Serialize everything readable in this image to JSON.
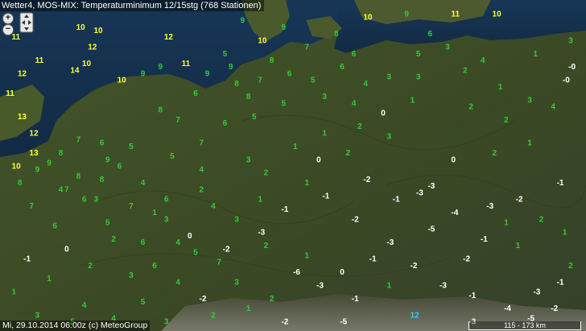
{
  "title": "Wetter4, MOS-MIX: Temperaturminimum 12/15stg (768 Stationen)",
  "footer": "Mi, 29.10.2014 06:00z (c) MeteoGroup",
  "scale_label": "115 - 173 km",
  "controls": {
    "zoom_in": "+",
    "zoom_out": "−"
  },
  "icons": {
    "pan": "pan-arrows-icon"
  },
  "colors": {
    "sea": "#15314e",
    "land": "#3a4a24",
    "cold": "#ffffff",
    "mild": "#33cc33",
    "warm": "#ffff33",
    "special": "#33ccff"
  },
  "stations": [
    [
      "10",
      13,
      8
    ],
    [
      "10",
      16,
      9
    ],
    [
      "11",
      2,
      11
    ],
    [
      "12",
      28,
      11
    ],
    [
      "12",
      15,
      14
    ],
    [
      "10",
      14,
      19
    ],
    [
      "14",
      12,
      21
    ],
    [
      "11",
      6,
      18
    ],
    [
      "12",
      3,
      22
    ],
    [
      "11",
      1,
      28
    ],
    [
      "13",
      3,
      35
    ],
    [
      "12",
      5,
      40
    ],
    [
      "13",
      5,
      46
    ],
    [
      "10",
      2,
      50
    ],
    [
      "9",
      8,
      49
    ],
    [
      "8",
      10,
      46
    ],
    [
      "7",
      13,
      42
    ],
    [
      "6",
      17,
      43
    ],
    [
      "5",
      22,
      44
    ],
    [
      "6",
      20,
      50
    ],
    [
      "4",
      24,
      55
    ],
    [
      "6",
      28,
      60
    ],
    [
      "4",
      30,
      73
    ],
    [
      "5",
      33,
      76
    ],
    [
      "7",
      37,
      79
    ],
    [
      "6",
      26,
      80
    ],
    [
      "6",
      24,
      73
    ],
    [
      "5",
      18,
      67
    ],
    [
      "7",
      22,
      62
    ],
    [
      "6",
      14,
      60
    ],
    [
      "8",
      13,
      53
    ],
    [
      "7",
      11,
      57
    ],
    [
      "8",
      17,
      54
    ],
    [
      "9",
      18,
      48
    ],
    [
      "10",
      20,
      24
    ],
    [
      "9",
      24,
      22
    ],
    [
      "9",
      27,
      20
    ],
    [
      "11",
      31,
      19
    ],
    [
      "9",
      35,
      22
    ],
    [
      "8",
      40,
      25
    ],
    [
      "7",
      44,
      24
    ],
    [
      "6",
      49,
      22
    ],
    [
      "5",
      53,
      24
    ],
    [
      "6",
      58,
      20
    ],
    [
      "4",
      62,
      25
    ],
    [
      "3",
      66,
      23
    ],
    [
      "3",
      71,
      23
    ],
    [
      "2",
      79,
      21
    ],
    [
      "1",
      85,
      26
    ],
    [
      "-0",
      96,
      24
    ],
    [
      "1",
      90,
      43
    ],
    [
      "2",
      84,
      46
    ],
    [
      "0",
      77,
      48
    ],
    [
      "-3",
      71,
      58
    ],
    [
      "-1",
      67,
      60
    ],
    [
      "-3",
      73,
      56
    ],
    [
      "-2",
      62,
      54
    ],
    [
      "-1",
      55,
      59
    ],
    [
      "1",
      52,
      55
    ],
    [
      "2",
      45,
      52
    ],
    [
      "3",
      42,
      48
    ],
    [
      "1",
      50,
      44
    ],
    [
      "1",
      55,
      40
    ],
    [
      "2",
      61,
      38
    ],
    [
      "3",
      66,
      41
    ],
    [
      "4",
      60,
      31
    ],
    [
      "3",
      55,
      29
    ],
    [
      "5",
      48,
      31
    ],
    [
      "5",
      43,
      35
    ],
    [
      "6",
      38,
      37
    ],
    [
      "7",
      34,
      43
    ],
    [
      "5",
      29,
      47
    ],
    [
      "4",
      34,
      51
    ],
    [
      "4",
      36,
      62
    ],
    [
      "3",
      40,
      66
    ],
    [
      "2",
      45,
      74
    ],
    [
      "1",
      52,
      77
    ],
    [
      "0",
      58,
      82
    ],
    [
      "-1",
      63,
      78
    ],
    [
      "-2",
      70,
      80
    ],
    [
      "-3",
      75,
      86
    ],
    [
      "-1",
      80,
      89
    ],
    [
      "-4",
      86,
      93
    ],
    [
      "-3",
      91,
      88
    ],
    [
      "-1",
      95,
      85
    ],
    [
      "2",
      98,
      80
    ],
    [
      "1",
      96,
      70
    ],
    [
      "2",
      92,
      66
    ],
    [
      "1",
      86,
      67
    ],
    [
      "-1",
      82,
      72
    ],
    [
      "-2",
      79,
      78
    ],
    [
      "1",
      88,
      74
    ],
    [
      "3",
      40,
      85
    ],
    [
      "4",
      30,
      85
    ],
    [
      "3",
      22,
      83
    ],
    [
      "2",
      15,
      80
    ],
    [
      "1",
      8,
      84
    ],
    [
      "1",
      2,
      88
    ],
    [
      "3",
      6,
      95
    ],
    [
      "4",
      14,
      92
    ],
    [
      "5",
      24,
      91
    ],
    [
      "2",
      36,
      95
    ],
    [
      "-2",
      48,
      97
    ],
    [
      "-5",
      58,
      97
    ],
    [
      "12",
      70,
      95
    ],
    [
      "-3",
      80,
      97
    ],
    [
      "-5",
      90,
      96
    ],
    [
      "-2",
      94,
      93
    ],
    [
      "8",
      42,
      29
    ],
    [
      "9",
      39,
      20
    ],
    [
      "10",
      44,
      12
    ],
    [
      "9",
      48,
      8
    ],
    [
      "7",
      52,
      14
    ],
    [
      "8",
      57,
      10
    ],
    [
      "6",
      60,
      16
    ],
    [
      "10",
      62,
      5
    ],
    [
      "9",
      69,
      2
    ],
    [
      "11",
      77,
      3
    ],
    [
      "10",
      84,
      3
    ],
    [
      "6",
      73,
      10
    ],
    [
      "5",
      71,
      16
    ],
    [
      "3",
      76,
      14
    ],
    [
      "4",
      82,
      18
    ],
    [
      "1",
      91,
      16
    ],
    [
      "3",
      97,
      12
    ],
    [
      "-0",
      97,
      20
    ],
    [
      "4",
      94,
      32
    ],
    [
      "-1",
      95,
      55
    ],
    [
      "-2",
      88,
      60
    ],
    [
      "-3",
      83,
      62
    ],
    [
      "-4",
      77,
      64
    ],
    [
      "-5",
      73,
      69
    ],
    [
      "-3",
      66,
      73
    ],
    [
      "-2",
      60,
      66
    ],
    [
      "1",
      44,
      60
    ],
    [
      "2",
      34,
      57
    ],
    [
      "3",
      28,
      66
    ],
    [
      "2",
      19,
      72
    ],
    [
      "0",
      11,
      75
    ],
    [
      "-1",
      4,
      78
    ],
    [
      "6",
      9,
      68
    ],
    [
      "7",
      5,
      62
    ],
    [
      "8",
      3,
      55
    ],
    [
      "9",
      6,
      51
    ],
    [
      "8",
      27,
      33
    ],
    [
      "7",
      30,
      36
    ],
    [
      "6",
      33,
      28
    ],
    [
      "5",
      38,
      16
    ],
    [
      "8",
      46,
      18
    ],
    [
      "9",
      41,
      6
    ],
    [
      "3",
      90,
      30
    ],
    [
      "2",
      86,
      36
    ],
    [
      "2",
      80,
      32
    ],
    [
      "1",
      70,
      30
    ],
    [
      "0",
      65,
      34
    ],
    [
      "2",
      59,
      46
    ],
    [
      "0",
      54,
      48
    ],
    [
      "-1",
      48,
      63
    ],
    [
      "-3",
      44,
      70
    ],
    [
      "-2",
      38,
      75
    ],
    [
      "0",
      32,
      71
    ],
    [
      "1",
      26,
      64
    ],
    [
      "3",
      16,
      60
    ],
    [
      "4",
      10,
      57
    ],
    [
      "1",
      66,
      86
    ],
    [
      "-1",
      60,
      90
    ],
    [
      "-3",
      54,
      86
    ],
    [
      "-6",
      50,
      82
    ],
    [
      "2",
      46,
      90
    ],
    [
      "1",
      42,
      93
    ],
    [
      "-2",
      34,
      90
    ],
    [
      "3",
      28,
      97
    ],
    [
      "4",
      19,
      96
    ],
    [
      "5",
      12,
      97
    ]
  ]
}
